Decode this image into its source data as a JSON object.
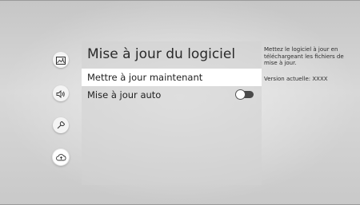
{
  "sidebar": {
    "items": [
      {
        "icon": "picture-icon"
      },
      {
        "icon": "sound-icon"
      },
      {
        "icon": "support-icon"
      },
      {
        "icon": "software-update-icon",
        "selected": true
      }
    ]
  },
  "panel": {
    "title": "Mise à jour du logiciel",
    "items": [
      {
        "label": "Mettre à jour maintenant"
      },
      {
        "label": "Mise à jour auto",
        "toggle": "off"
      }
    ]
  },
  "info": {
    "description": "Mettez le logiciel à jour en téléchargeant les fichiers de mise à jour.",
    "version": "Version actuelle: XXXX"
  }
}
